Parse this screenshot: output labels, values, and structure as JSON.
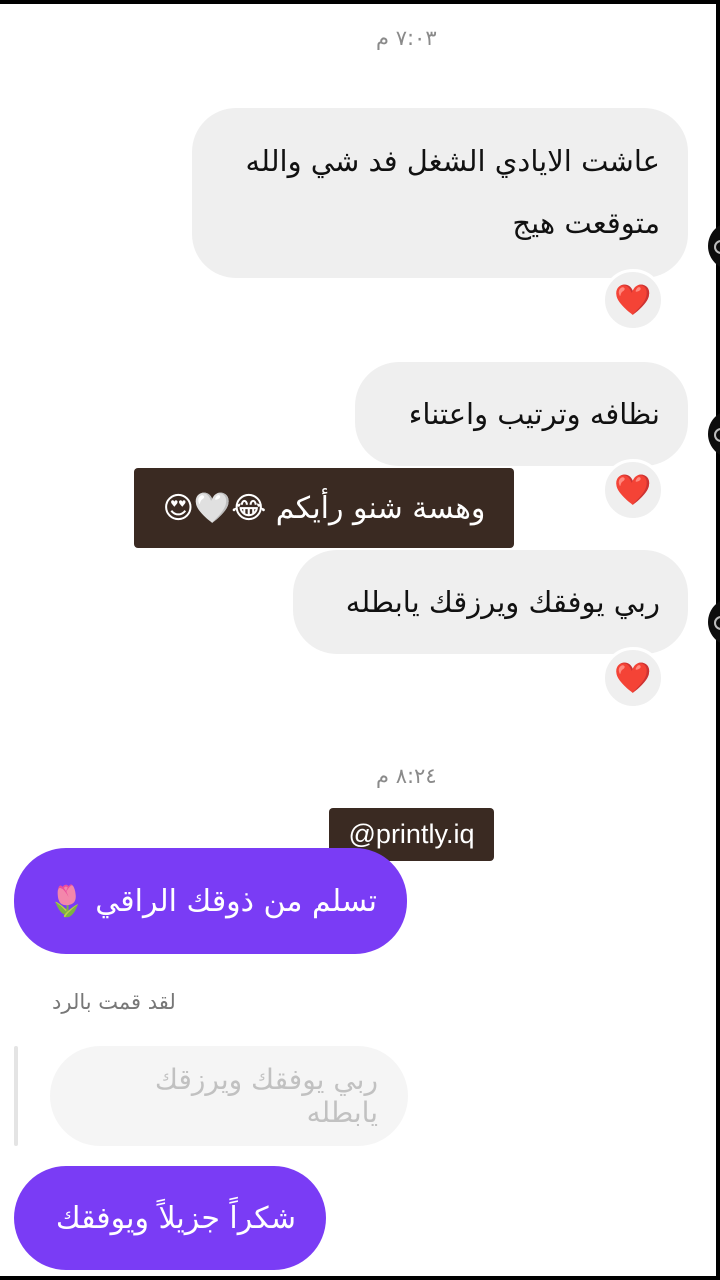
{
  "timestamps": [
    "٧:٠٣ م",
    "٨:٢٤ م"
  ],
  "incoming": [
    {
      "line1": "عاشت الايادي الشغل فد شي والله",
      "line2": "متوقعت هيج",
      "reaction": "❤️"
    },
    {
      "text": "نظافه وترتيب واعتناء",
      "reaction": "❤️"
    },
    {
      "text": "ربي يوفقك ويرزقك يابطله",
      "reaction": "❤️"
    }
  ],
  "overlay_caption": "وهسة شنو رأيكم 😂🤍😍",
  "watermark": "@printly.iq",
  "outgoing": [
    {
      "text": "تسلم من ذوقك الراقي 🌷"
    },
    {
      "text": "شكراً جزيلاً ويوفقك"
    }
  ],
  "reply": {
    "label": "لقد قمت بالرد",
    "quoted_text": "ربي يوفقك ويرزقك يابطله"
  },
  "colors": {
    "outgoing_bubble": "#7a3cf5",
    "incoming_bubble": "#efefef",
    "overlay": "#3a2a22"
  }
}
